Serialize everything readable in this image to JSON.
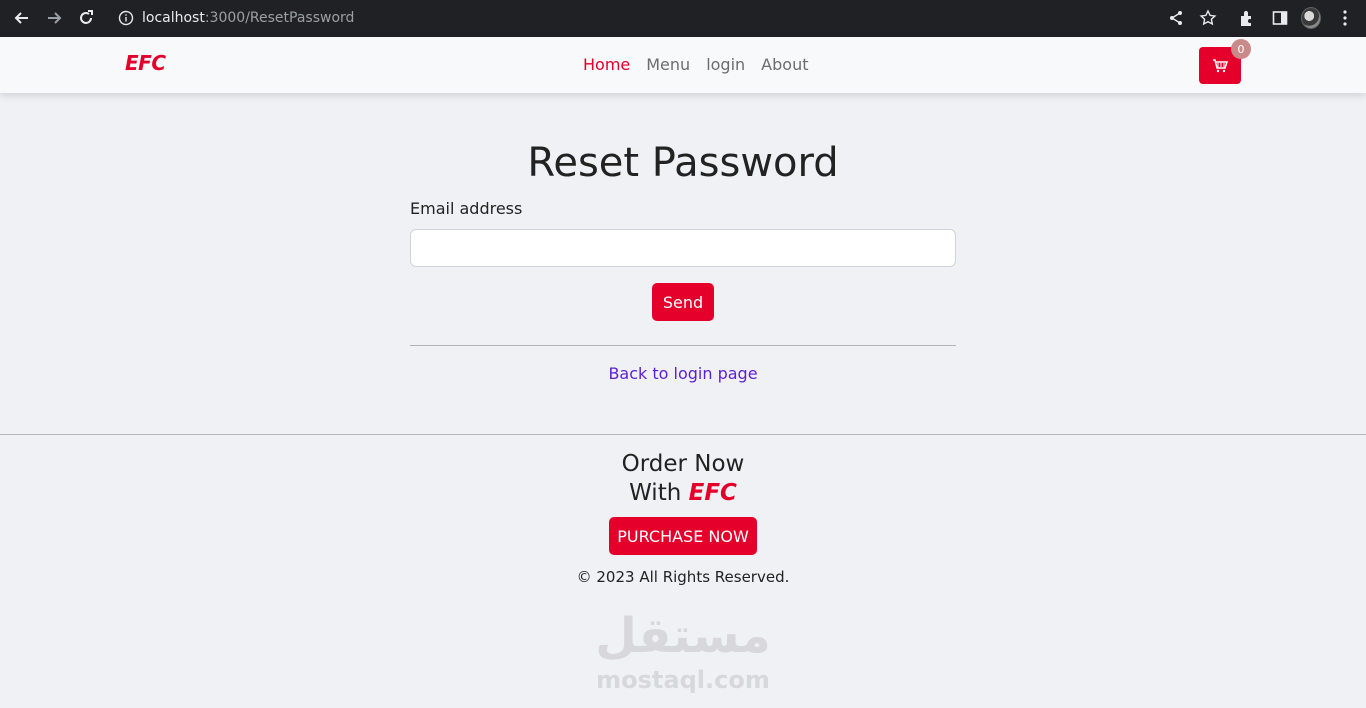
{
  "browser": {
    "url_host": "localhost",
    "url_rest": ":3000/ResetPassword"
  },
  "navbar": {
    "brand": "EFC",
    "links": [
      "Home",
      "Menu",
      "login",
      "About"
    ],
    "active": "Home",
    "cart_count": "0"
  },
  "form": {
    "title": "Reset Password",
    "email_label": "Email address",
    "email_value": "",
    "send_label": "Send",
    "back_link": "Back to login page"
  },
  "footer": {
    "order_line1": "Order Now",
    "order_with": "With",
    "order_brand": "EFC",
    "purchase_label": "PURCHASE NOW",
    "copyright": "© 2023 All Rights Reserved."
  },
  "watermark": {
    "arabic": "مستقل",
    "latin": "mostaql.com"
  },
  "colors": {
    "brand_red": "#e4002b",
    "link_purple": "#5a1fd6",
    "page_bg": "#f0f1f5"
  }
}
